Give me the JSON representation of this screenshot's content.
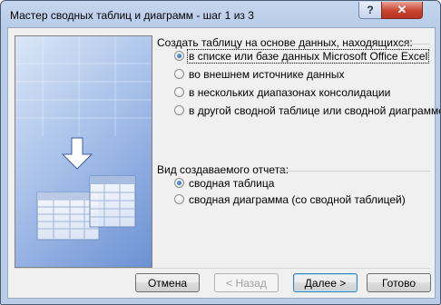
{
  "window": {
    "title": "Мастер сводных таблиц и диаграмм - шаг 1 из 3"
  },
  "titlebar": {
    "help_label": "?",
    "close_label": "✕"
  },
  "source_group": {
    "label": "Создать таблицу на основе данных, находящихся:",
    "options": [
      {
        "label": "в списке или базе данных Microsoft Office Excel",
        "checked": true
      },
      {
        "label": "во внешнем источнике данных",
        "checked": false
      },
      {
        "label": "в нескольких диапазонах консолидации",
        "checked": false
      },
      {
        "label": "в другой сводной таблице или сводной диаграмме",
        "checked": false
      }
    ]
  },
  "report_group": {
    "label": "Вид создаваемого отчета:",
    "options": [
      {
        "label": "сводная таблица",
        "checked": true
      },
      {
        "label": "сводная диаграмма (со сводной таблицей)",
        "checked": false
      }
    ]
  },
  "buttons": {
    "cancel": "Отмена",
    "back": "< Назад",
    "next": "Далее >",
    "finish": "Готово"
  }
}
